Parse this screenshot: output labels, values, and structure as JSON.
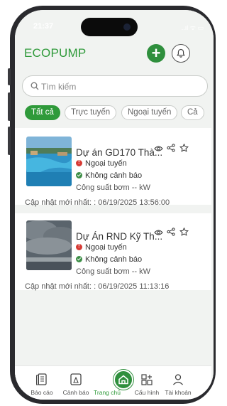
{
  "status_bar": {
    "time": "21:37",
    "icons": "..ıl ᯤ ▭"
  },
  "header": {
    "brand": "ECOPUMP",
    "add_label": "+",
    "add_icon": "plus-icon",
    "bell_icon": "bell-icon"
  },
  "search": {
    "placeholder": "Tìm kiếm",
    "value": ""
  },
  "filters": [
    {
      "label": "Tất cả",
      "active": true
    },
    {
      "label": "Trực tuyến",
      "active": false
    },
    {
      "label": "Ngoại tuyến",
      "active": false
    },
    {
      "label": "Cả",
      "active": false
    }
  ],
  "projects": [
    {
      "title": "Dự án GD170 Thà...",
      "status_offline": "Ngoại tuyến",
      "status_alert": "Không cảnh báo",
      "power": "Công suất bơm -- kW",
      "updated": "Cập nhật mới nhất: : 06/19/2025 13:56:00",
      "thumb": "pool-photo"
    },
    {
      "title": "Dự Án RND Kỹ Th...",
      "status_offline": "Ngoại tuyến",
      "status_alert": "Không cảnh báo",
      "power": "Công suất bơm -- kW",
      "updated": "Cập nhật mới nhất: : 06/19/2025 11:13:16",
      "thumb": "cloudy-sky-photo"
    }
  ],
  "tabs": [
    {
      "label": "Báo cáo",
      "icon": "report-icon",
      "active": false
    },
    {
      "label": "Cảnh báo",
      "icon": "alert-icon",
      "active": false
    },
    {
      "label": "Trang chủ",
      "icon": "home-icon",
      "active": true
    },
    {
      "label": "Cấu hình",
      "icon": "config-icon",
      "active": false
    },
    {
      "label": "Tài khoản",
      "icon": "account-icon",
      "active": false
    }
  ],
  "colors": {
    "brand": "#2f9a3a",
    "offline": "#d63a34",
    "ok": "#3c8e46"
  }
}
